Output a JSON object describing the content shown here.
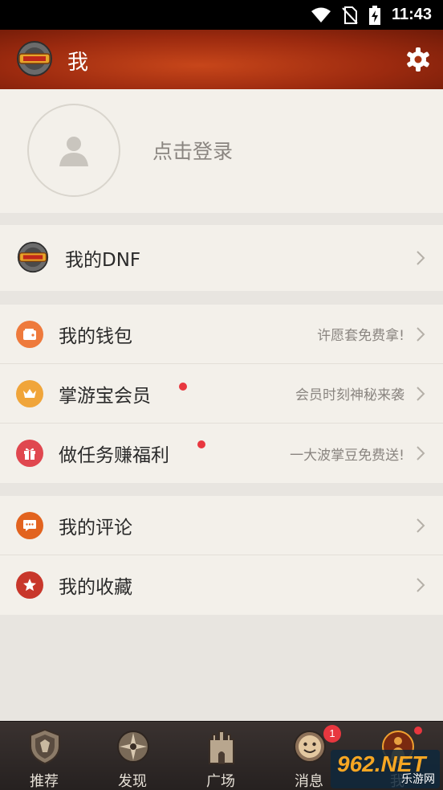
{
  "status_bar": {
    "time": "11:43"
  },
  "header": {
    "title": "我"
  },
  "profile": {
    "login_label": "点击登录"
  },
  "sections": {
    "dnf": {
      "label": "我的DNF"
    },
    "wallet": {
      "label": "我的钱包",
      "sub": "许愿套免费拿!"
    },
    "vip": {
      "label": "掌游宝会员",
      "sub": "会员时刻神秘来袭"
    },
    "tasks": {
      "label": "做任务赚福利",
      "sub": "一大波掌豆免费送!"
    },
    "comments": {
      "label": "我的评论"
    },
    "favorites": {
      "label": "我的收藏"
    }
  },
  "tabs": [
    {
      "label": "推荐"
    },
    {
      "label": "发现"
    },
    {
      "label": "广场"
    },
    {
      "label": "消息",
      "badge": "1"
    },
    {
      "label": "我"
    }
  ],
  "watermark": {
    "brand": "962.NET",
    "sub": "乐游网"
  },
  "colors": {
    "header": "#b43a14",
    "wallet_icon": "#ee7a3c",
    "vip_icon": "#f0a53a",
    "tasks_icon": "#e0474f",
    "comments_icon": "#e2631f",
    "favorites_icon": "#c8372b",
    "badge": "#e8373f"
  }
}
